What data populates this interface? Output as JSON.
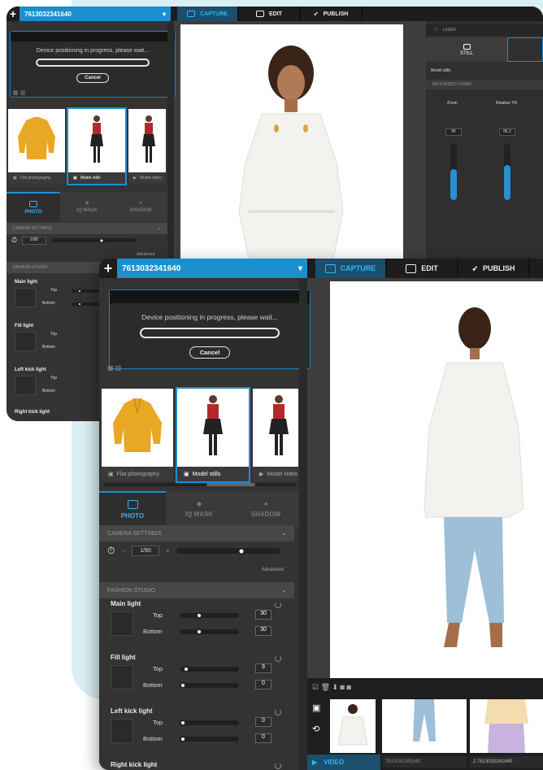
{
  "top_bar": {
    "serial_back": "7613032341640",
    "serial_front": "7613032341640",
    "capture_label": "CAPTURE",
    "edit_label": "EDIT",
    "publish_label": "PUBLISH"
  },
  "dialog": {
    "message": "Device positioning in progress, please wait...",
    "cancel_label": "Cancel"
  },
  "thumbnails": [
    {
      "label": "Flat photography",
      "selected": false
    },
    {
      "label": "Model stills",
      "selected": true
    },
    {
      "label": "Model video",
      "selected": false
    }
  ],
  "subtabs": [
    "PHOTO",
    "IQ MASK",
    "SHADOW"
  ],
  "camera_settings": {
    "title": "CAMERA SETTINGS",
    "shutter": "1/80",
    "advanced_label": "Advanced"
  },
  "fashion_studio": {
    "title": "FASHION STUDIO"
  },
  "lights": [
    {
      "name": "Main light",
      "top": "30",
      "bottom": "30"
    },
    {
      "name": "Fill light",
      "top": "9",
      "bottom": "0"
    },
    {
      "name": "Left kick light",
      "top": "0",
      "bottom": "0"
    },
    {
      "name": "Right kick light"
    }
  ],
  "light_labels": {
    "top": "Top",
    "bottom": "Bottom"
  },
  "back_right_panel": {
    "laser_label": "LASER",
    "still_label": "STILL",
    "model_stills": "Model stills",
    "motorized_stand": "MOTORIZED STAND",
    "zoom_label": "Zoom",
    "tilt_label": "Relative Tilt",
    "zoom_value": "86",
    "tilt_value": "86.2"
  },
  "bottom_strip": {
    "video_label": "VIDEO",
    "serial_1": "7613032341640",
    "serial_2": "2.7613032341640"
  },
  "colors": {
    "accent": "#1b8fd0",
    "dark": "#1d1d1d",
    "panel": "#333333",
    "background": "#daeff3"
  }
}
